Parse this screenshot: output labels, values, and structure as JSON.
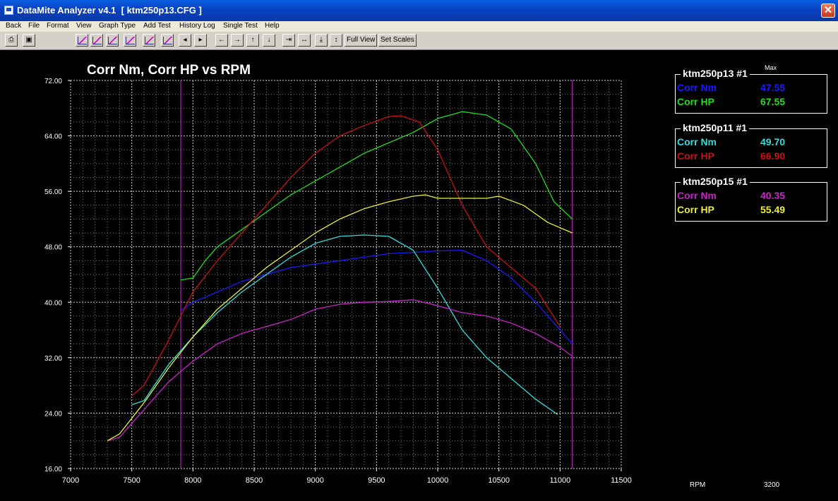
{
  "window": {
    "title": "DataMite Analyzer v4.1  [ ktm250p13.CFG ]",
    "close_label": "✕"
  },
  "menu": [
    "Back",
    "File",
    "Format",
    "View",
    "Graph Type",
    "Add Test",
    "History Log",
    "Single Test",
    "Help"
  ],
  "toolbar": {
    "full_view_label": "Full View",
    "set_scales_label": "Set Scales"
  },
  "legend": {
    "max_label": "Max",
    "groups": [
      {
        "name": "ktm250p13",
        "suffix": "#1",
        "rows": [
          {
            "label": "Corr Nm",
            "value": "47.55",
            "color": "#1a1aff"
          },
          {
            "label": "Corr HP",
            "value": "67.55",
            "color": "#22dd22"
          }
        ]
      },
      {
        "name": "ktm250p11",
        "suffix": "#1",
        "rows": [
          {
            "label": "Corr Nm",
            "value": "49.70",
            "color": "#33dddd"
          },
          {
            "label": "Corr HP",
            "value": "66.90",
            "color": "#cc1111"
          }
        ]
      },
      {
        "name": "ktm250p15",
        "suffix": "#1",
        "rows": [
          {
            "label": "Corr Nm",
            "value": "40.35",
            "color": "#cc22cc"
          },
          {
            "label": "Corr HP",
            "value": "55.49",
            "color": "#eeee33"
          }
        ]
      }
    ]
  },
  "status": {
    "rpm_label": "RPM",
    "rpm_value": "3200"
  },
  "chart_data": {
    "type": "line",
    "title": "Corr Nm, Corr HP vs RPM",
    "xlabel": "",
    "ylabel": "",
    "xlim": [
      7000,
      11500
    ],
    "ylim": [
      16,
      72
    ],
    "x_ticks": [
      "7000",
      "7500",
      "8000",
      "8500",
      "9000",
      "9500",
      "10000",
      "10500",
      "11000",
      "11500"
    ],
    "y_ticks": [
      "16.00",
      "24.00",
      "32.00",
      "40.00",
      "48.00",
      "56.00",
      "64.00",
      "72.00"
    ],
    "grid": true,
    "vertical_markers": [
      7900,
      11100
    ],
    "series": [
      {
        "name": "ktm250p13 Corr Nm",
        "color": "#1a1aff",
        "points": [
          [
            7900,
            38.8
          ],
          [
            8000,
            40.0
          ],
          [
            8200,
            41.5
          ],
          [
            8400,
            43.0
          ],
          [
            8600,
            44.0
          ],
          [
            8800,
            45.0
          ],
          [
            9000,
            45.5
          ],
          [
            9200,
            46.0
          ],
          [
            9400,
            46.5
          ],
          [
            9600,
            47.0
          ],
          [
            9800,
            47.2
          ],
          [
            10000,
            47.4
          ],
          [
            10200,
            47.5
          ],
          [
            10400,
            46.0
          ],
          [
            10600,
            43.5
          ],
          [
            10800,
            40.0
          ],
          [
            11000,
            36.0
          ],
          [
            11100,
            34.0
          ]
        ]
      },
      {
        "name": "ktm250p13 Corr HP",
        "color": "#22dd22",
        "points": [
          [
            7900,
            43.2
          ],
          [
            8000,
            43.5
          ],
          [
            8100,
            46.0
          ],
          [
            8200,
            48.0
          ],
          [
            8400,
            50.5
          ],
          [
            8600,
            53.0
          ],
          [
            8800,
            55.5
          ],
          [
            9000,
            57.5
          ],
          [
            9200,
            59.5
          ],
          [
            9400,
            61.5
          ],
          [
            9600,
            63.0
          ],
          [
            9800,
            64.5
          ],
          [
            10000,
            66.5
          ],
          [
            10200,
            67.5
          ],
          [
            10400,
            67.0
          ],
          [
            10600,
            65.0
          ],
          [
            10800,
            60.0
          ],
          [
            10950,
            54.5
          ],
          [
            11100,
            52.0
          ]
        ]
      },
      {
        "name": "ktm250p11 Corr Nm",
        "color": "#33dddd",
        "points": [
          [
            7500,
            25.2
          ],
          [
            7600,
            25.8
          ],
          [
            7800,
            31.0
          ],
          [
            8000,
            35.0
          ],
          [
            8200,
            38.5
          ],
          [
            8400,
            41.5
          ],
          [
            8600,
            44.0
          ],
          [
            8800,
            46.5
          ],
          [
            9000,
            48.5
          ],
          [
            9200,
            49.5
          ],
          [
            9400,
            49.7
          ],
          [
            9600,
            49.5
          ],
          [
            9800,
            47.5
          ],
          [
            10000,
            42.0
          ],
          [
            10200,
            36.0
          ],
          [
            10400,
            32.0
          ],
          [
            10600,
            29.0
          ],
          [
            10800,
            26.0
          ],
          [
            10980,
            23.8
          ]
        ]
      },
      {
        "name": "ktm250p11 Corr HP",
        "color": "#cc1111",
        "points": [
          [
            7500,
            26.5
          ],
          [
            7600,
            28.0
          ],
          [
            7800,
            34.5
          ],
          [
            8000,
            41.5
          ],
          [
            8200,
            46.0
          ],
          [
            8400,
            50.0
          ],
          [
            8600,
            54.0
          ],
          [
            8800,
            58.0
          ],
          [
            9000,
            61.5
          ],
          [
            9200,
            64.0
          ],
          [
            9400,
            65.5
          ],
          [
            9600,
            66.8
          ],
          [
            9700,
            66.9
          ],
          [
            9850,
            66.0
          ],
          [
            10000,
            62.0
          ],
          [
            10200,
            54.0
          ],
          [
            10400,
            48.0
          ],
          [
            10600,
            45.0
          ],
          [
            10800,
            42.0
          ],
          [
            11000,
            36.5
          ]
        ]
      },
      {
        "name": "ktm250p15 Corr Nm",
        "color": "#cc22cc",
        "points": [
          [
            7300,
            20.0
          ],
          [
            7400,
            20.5
          ],
          [
            7600,
            24.5
          ],
          [
            7800,
            28.5
          ],
          [
            8000,
            31.5
          ],
          [
            8200,
            34.0
          ],
          [
            8400,
            35.5
          ],
          [
            8600,
            36.5
          ],
          [
            8800,
            37.5
          ],
          [
            9000,
            39.0
          ],
          [
            9200,
            39.7
          ],
          [
            9400,
            40.0
          ],
          [
            9600,
            40.1
          ],
          [
            9800,
            40.35
          ],
          [
            10000,
            39.5
          ],
          [
            10200,
            38.5
          ],
          [
            10400,
            38.0
          ],
          [
            10600,
            37.0
          ],
          [
            10800,
            35.5
          ],
          [
            11000,
            33.5
          ],
          [
            11100,
            32.2
          ]
        ]
      },
      {
        "name": "ktm250p15 Corr HP",
        "color": "#eeee33",
        "points": [
          [
            7300,
            20.0
          ],
          [
            7400,
            21.0
          ],
          [
            7600,
            25.5
          ],
          [
            7800,
            30.5
          ],
          [
            8000,
            35.0
          ],
          [
            8200,
            39.0
          ],
          [
            8400,
            42.0
          ],
          [
            8600,
            45.0
          ],
          [
            8800,
            47.5
          ],
          [
            9000,
            50.0
          ],
          [
            9200,
            52.0
          ],
          [
            9400,
            53.5
          ],
          [
            9600,
            54.5
          ],
          [
            9800,
            55.3
          ],
          [
            9900,
            55.49
          ],
          [
            10000,
            55.0
          ],
          [
            10200,
            55.0
          ],
          [
            10400,
            55.0
          ],
          [
            10500,
            55.3
          ],
          [
            10700,
            54.0
          ],
          [
            10900,
            51.5
          ],
          [
            11100,
            50.0
          ]
        ]
      }
    ]
  }
}
